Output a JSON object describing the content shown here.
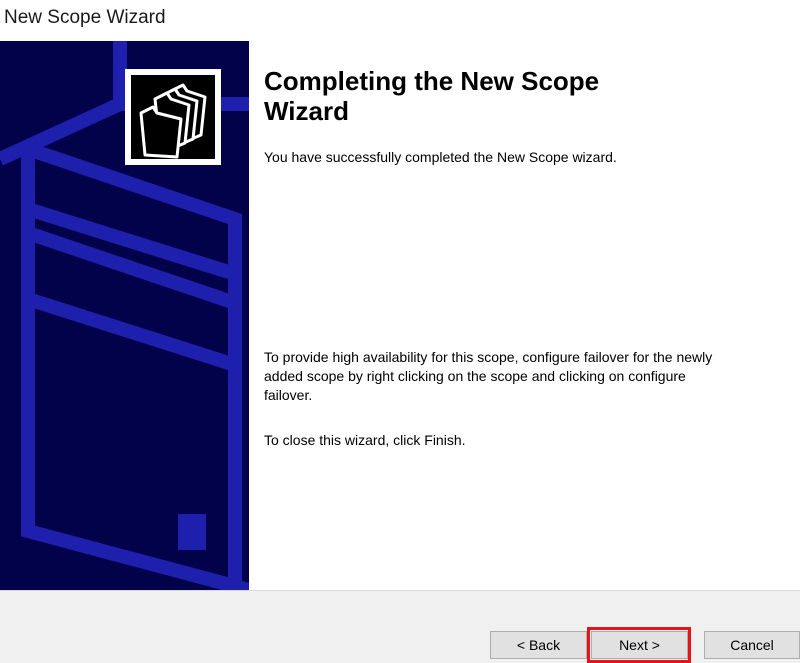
{
  "window": {
    "title": "New Scope Wizard"
  },
  "side_panel": {
    "logo_icon": "folder-stack-icon",
    "background_color": "#02024a",
    "art_color": "#1f1fae"
  },
  "content": {
    "heading": "Completing the New Scope Wizard",
    "success_message": "You have successfully completed the New Scope wizard.",
    "failover_message": "To provide high availability for this scope, configure failover for the newly added scope by right clicking on the scope and clicking on configure failover.",
    "close_message": "To close this wizard, click Finish."
  },
  "buttons": {
    "back_label": "< Back",
    "next_label": "Next >",
    "cancel_label": "Cancel"
  },
  "highlight_color": "#e8121b"
}
